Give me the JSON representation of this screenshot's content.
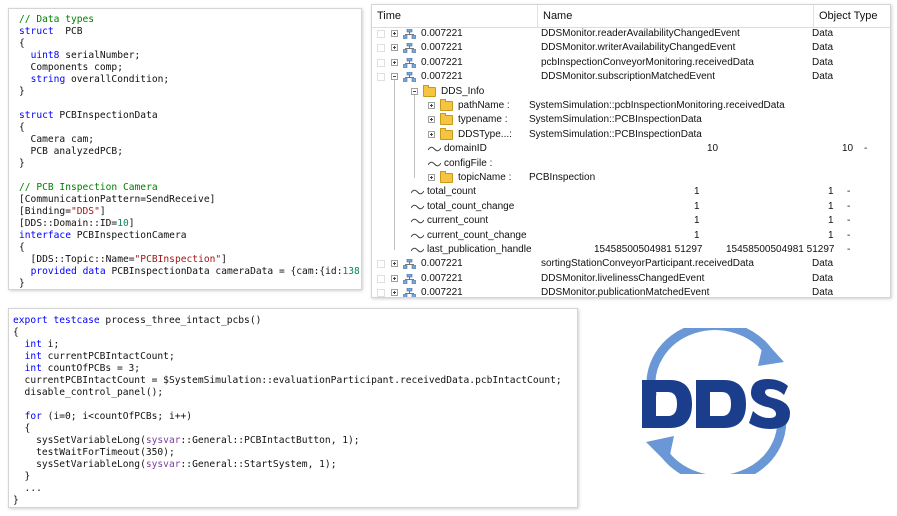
{
  "code_types": {
    "lines": [
      [
        [
          "cm",
          "// Data types"
        ]
      ],
      [
        [
          "kw",
          "struct"
        ],
        [
          "",
          "  PCB"
        ]
      ],
      [
        [
          "",
          "{"
        ]
      ],
      [
        [
          "",
          "  "
        ],
        [
          "kw",
          "uint8"
        ],
        [
          "",
          " serialNumber;"
        ]
      ],
      [
        [
          "",
          "  Components comp;"
        ]
      ],
      [
        [
          "",
          "  "
        ],
        [
          "kw",
          "string"
        ],
        [
          "",
          " overallCondition;"
        ]
      ],
      [
        [
          "",
          "}"
        ]
      ],
      [
        [
          "",
          ""
        ]
      ],
      [
        [
          "kw",
          "struct"
        ],
        [
          "",
          " PCBInspectionData"
        ]
      ],
      [
        [
          "",
          "{"
        ]
      ],
      [
        [
          "",
          "  Camera cam;"
        ]
      ],
      [
        [
          "",
          "  PCB analyzedPCB;"
        ]
      ],
      [
        [
          "",
          "}"
        ]
      ],
      [
        [
          "",
          ""
        ]
      ],
      [
        [
          "cm",
          "// PCB Inspection Camera"
        ]
      ],
      [
        [
          "",
          "[CommunicationPattern=SendReceive]"
        ]
      ],
      [
        [
          "",
          "[Binding="
        ],
        [
          "st",
          "\"DDS\""
        ],
        [
          "",
          "]"
        ]
      ],
      [
        [
          "",
          "[DDS::Domain::ID="
        ],
        [
          "nu",
          "10"
        ],
        [
          "",
          "]"
        ]
      ],
      [
        [
          "kw",
          "interface"
        ],
        [
          "",
          " PCBInspectionCamera"
        ]
      ],
      [
        [
          "",
          "{"
        ]
      ],
      [
        [
          "",
          "  [DDS::Topic::Name="
        ],
        [
          "st",
          "\"PCBInspection\""
        ],
        [
          "",
          "]"
        ]
      ],
      [
        [
          "",
          "  "
        ],
        [
          "kw",
          "provided"
        ],
        [
          "",
          " "
        ],
        [
          "kw",
          "data"
        ],
        [
          "",
          " PCBInspectionData cameraData = {cam:{id:"
        ],
        [
          "nu",
          "138"
        ],
        [
          "",
          "}};"
        ]
      ],
      [
        [
          "",
          "}"
        ]
      ]
    ]
  },
  "code_testcase": {
    "lines": [
      [
        [
          "kw",
          "export"
        ],
        [
          "",
          " "
        ],
        [
          "kw",
          "testcase"
        ],
        [
          "",
          " process_three_intact_pcbs()"
        ]
      ],
      [
        [
          "",
          "{"
        ]
      ],
      [
        [
          "",
          "  "
        ],
        [
          "kw",
          "int"
        ],
        [
          "",
          " i;"
        ]
      ],
      [
        [
          "",
          "  "
        ],
        [
          "kw",
          "int"
        ],
        [
          "",
          " currentPCBIntactCount;"
        ]
      ],
      [
        [
          "",
          "  "
        ],
        [
          "kw",
          "int"
        ],
        [
          "",
          " countOfPCBs = 3;"
        ]
      ],
      [
        [
          "",
          "  currentPCBIntactCount = $SystemSimulation::evaluationParticipant.receivedData.pcbIntactCount;"
        ]
      ],
      [
        [
          "",
          "  disable_control_panel();"
        ]
      ],
      [
        [
          "",
          ""
        ]
      ],
      [
        [
          "",
          "  "
        ],
        [
          "kw",
          "for"
        ],
        [
          "",
          " (i=0; i<countOfPCBs; i++)"
        ]
      ],
      [
        [
          "",
          "  {"
        ]
      ],
      [
        [
          "",
          "    sysSetVariableLong("
        ],
        [
          "sy",
          "sysvar"
        ],
        [
          "",
          "::General::PCBIntactButton, 1);"
        ]
      ],
      [
        [
          "",
          "    testWaitForTimeout(350);"
        ]
      ],
      [
        [
          "",
          "    sysSetVariableLong("
        ],
        [
          "sy",
          "sysvar"
        ],
        [
          "",
          "::General::StartSystem, 1);"
        ]
      ],
      [
        [
          "",
          "  }"
        ]
      ],
      [
        [
          "",
          "  ..."
        ]
      ],
      [
        [
          "",
          "}"
        ]
      ]
    ]
  },
  "trace": {
    "columns": {
      "time": "Time",
      "name": "Name",
      "object_type": "Object Type"
    },
    "rows": [
      {
        "indent": 0,
        "expand": "plus",
        "icon": "network",
        "time": "0.007221",
        "name": "DDSMonitor.readerAvailabilityChangedEvent",
        "type": "Data",
        "value": "",
        "value2": "",
        "dash": ""
      },
      {
        "indent": 0,
        "expand": "plus",
        "icon": "network",
        "time": "0.007221",
        "name": "DDSMonitor.writerAvailabilityChangedEvent",
        "type": "Data",
        "value": "",
        "value2": "",
        "dash": ""
      },
      {
        "indent": 0,
        "expand": "plus",
        "icon": "network",
        "time": "0.007221",
        "name": "pcbInspectionConveyorMonitoring.receivedData",
        "type": "Data",
        "value": "",
        "value2": "",
        "dash": ""
      },
      {
        "indent": 0,
        "expand": "minus",
        "icon": "network",
        "time": "0.007221",
        "name": "DDSMonitor.subscriptionMatchedEvent",
        "type": "Data",
        "value": "",
        "value2": "",
        "dash": ""
      },
      {
        "indent": 1,
        "expand": "minus",
        "icon": "folder",
        "time": "DDS_Info",
        "name": "",
        "type": "",
        "value": "",
        "value2": "",
        "dash": ""
      },
      {
        "indent": 2,
        "expand": "plus",
        "icon": "folder",
        "time": "pathName  :",
        "name": "SystemSimulation::pcbInspectionMonitoring.receivedData",
        "type": "",
        "value": "",
        "value2": "",
        "dash": ""
      },
      {
        "indent": 2,
        "expand": "plus",
        "icon": "folder",
        "time": "typename  :",
        "name": "SystemSimulation::PCBInspectionData",
        "type": "",
        "value": "",
        "value2": "",
        "dash": ""
      },
      {
        "indent": 2,
        "expand": "plus",
        "icon": "folder",
        "time": "DDSType...:",
        "name": "SystemSimulation::PCBInspectionData",
        "type": "",
        "value": "",
        "value2": "",
        "dash": ""
      },
      {
        "indent": 2,
        "expand": "",
        "icon": "wave",
        "time": "domainID",
        "name": "",
        "type": "",
        "value": "10",
        "value2": "10",
        "dash": "-"
      },
      {
        "indent": 2,
        "expand": "",
        "icon": "wave",
        "time": "configFile  :",
        "name": "",
        "type": "",
        "value": "",
        "value2": "",
        "dash": ""
      },
      {
        "indent": 2,
        "expand": "plus",
        "icon": "folder",
        "time": "topicName  :",
        "name": "PCBInspection",
        "type": "",
        "value": "",
        "value2": "",
        "dash": ""
      },
      {
        "indent": 1,
        "expand": "",
        "icon": "wave",
        "time": "total_count",
        "name": "",
        "type": "",
        "value": "1",
        "value2": "1",
        "dash": "-"
      },
      {
        "indent": 1,
        "expand": "",
        "icon": "wave",
        "time": "total_count_change",
        "name": "",
        "type": "",
        "value": "1",
        "value2": "1",
        "dash": "-"
      },
      {
        "indent": 1,
        "expand": "",
        "icon": "wave",
        "time": "current_count",
        "name": "",
        "type": "",
        "value": "1",
        "value2": "1",
        "dash": "-"
      },
      {
        "indent": 1,
        "expand": "",
        "icon": "wave",
        "time": "current_count_change",
        "name": "",
        "type": "",
        "value": "1",
        "value2": "1",
        "dash": "-"
      },
      {
        "indent": 1,
        "expand": "",
        "icon": "wave",
        "time": "last_publication_handle",
        "name": "",
        "type": "",
        "value": "15458500504981 51297",
        "value2": "15458500504981 51297",
        "dash": "-"
      },
      {
        "indent": 0,
        "expand": "plus",
        "icon": "network",
        "time": "0.007221",
        "name": "sortingStationConveyorParticipant.receivedData",
        "type": "Data",
        "value": "",
        "value2": "",
        "dash": ""
      },
      {
        "indent": 0,
        "expand": "plus",
        "icon": "network",
        "time": "0.007221",
        "name": "DDSMonitor.livelinessChangedEvent",
        "type": "Data",
        "value": "",
        "value2": "",
        "dash": ""
      },
      {
        "indent": 0,
        "expand": "plus",
        "icon": "network",
        "time": "0.007221",
        "name": "DDSMonitor.publicationMatchedEvent",
        "type": "Data",
        "value": "",
        "value2": "",
        "dash": ""
      }
    ]
  },
  "logo": {
    "text": "DDS",
    "colors": {
      "dark": "#1b3e8c",
      "light": "#6a98d6"
    }
  }
}
